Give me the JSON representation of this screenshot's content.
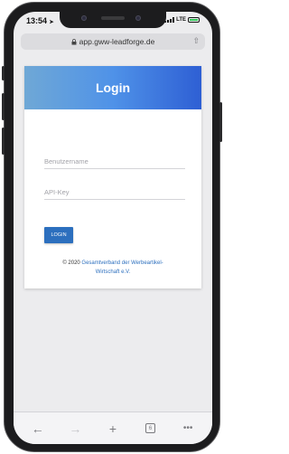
{
  "status_bar": {
    "time": "13:54",
    "carrier": "LTE"
  },
  "browser": {
    "url": "app.gww-leadforge.de",
    "open_tabs": "6"
  },
  "login": {
    "title": "Login",
    "username_placeholder": "Benutzername",
    "apikey_placeholder": "API-Key",
    "button_label": "LOGIN",
    "copyright_prefix": "© 2020 ",
    "copyright_link_line1": "Gesamtverband der Werbeartikel-",
    "copyright_link_line2": "Wirtschaft e.V."
  },
  "colors": {
    "header_gradient": [
      "#6fa8d6",
      "#2e5fd4"
    ],
    "button": "#2c6fbe",
    "link": "#2c6fbe"
  },
  "icons": [
    "location-arrow-icon",
    "signal-icon",
    "battery-icon",
    "lock-icon",
    "share-icon",
    "back-icon",
    "forward-icon",
    "new-tab-icon",
    "tabs-icon",
    "more-icon"
  ]
}
